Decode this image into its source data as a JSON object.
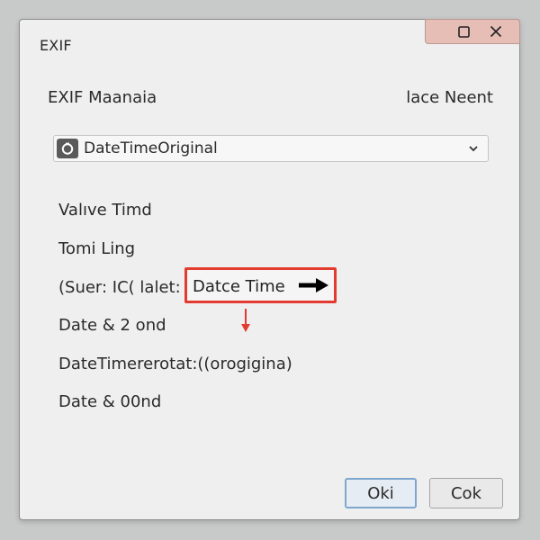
{
  "window": {
    "title": "EXIF",
    "maximize_icon": "maximize-icon",
    "close_icon": "close-icon",
    "controls_color": "#e6beb6"
  },
  "header": {
    "left_label": "EXIF Maanaia",
    "right_label": "lace Neent"
  },
  "tag_select": {
    "icon": "camera-icon",
    "value": "DateTimeOriginal",
    "chevron": "chevron-down-icon"
  },
  "rows": [
    "Valıve Timd",
    "Tomi Ling",
    "(Suer: IC( lalet:",
    "Date & 2 ond",
    "DateTimererotat:((orogigina)",
    "Date & 00nd"
  ],
  "highlight": {
    "text": "Datce Time",
    "arrow_icon": "arrow-right-icon",
    "border_color": "#e33b2f"
  },
  "annotation": {
    "arrow_icon": "arrow-down-icon",
    "color": "#e33b2f"
  },
  "buttons": {
    "ok_label": "Oki",
    "cancel_label": "Cok"
  }
}
